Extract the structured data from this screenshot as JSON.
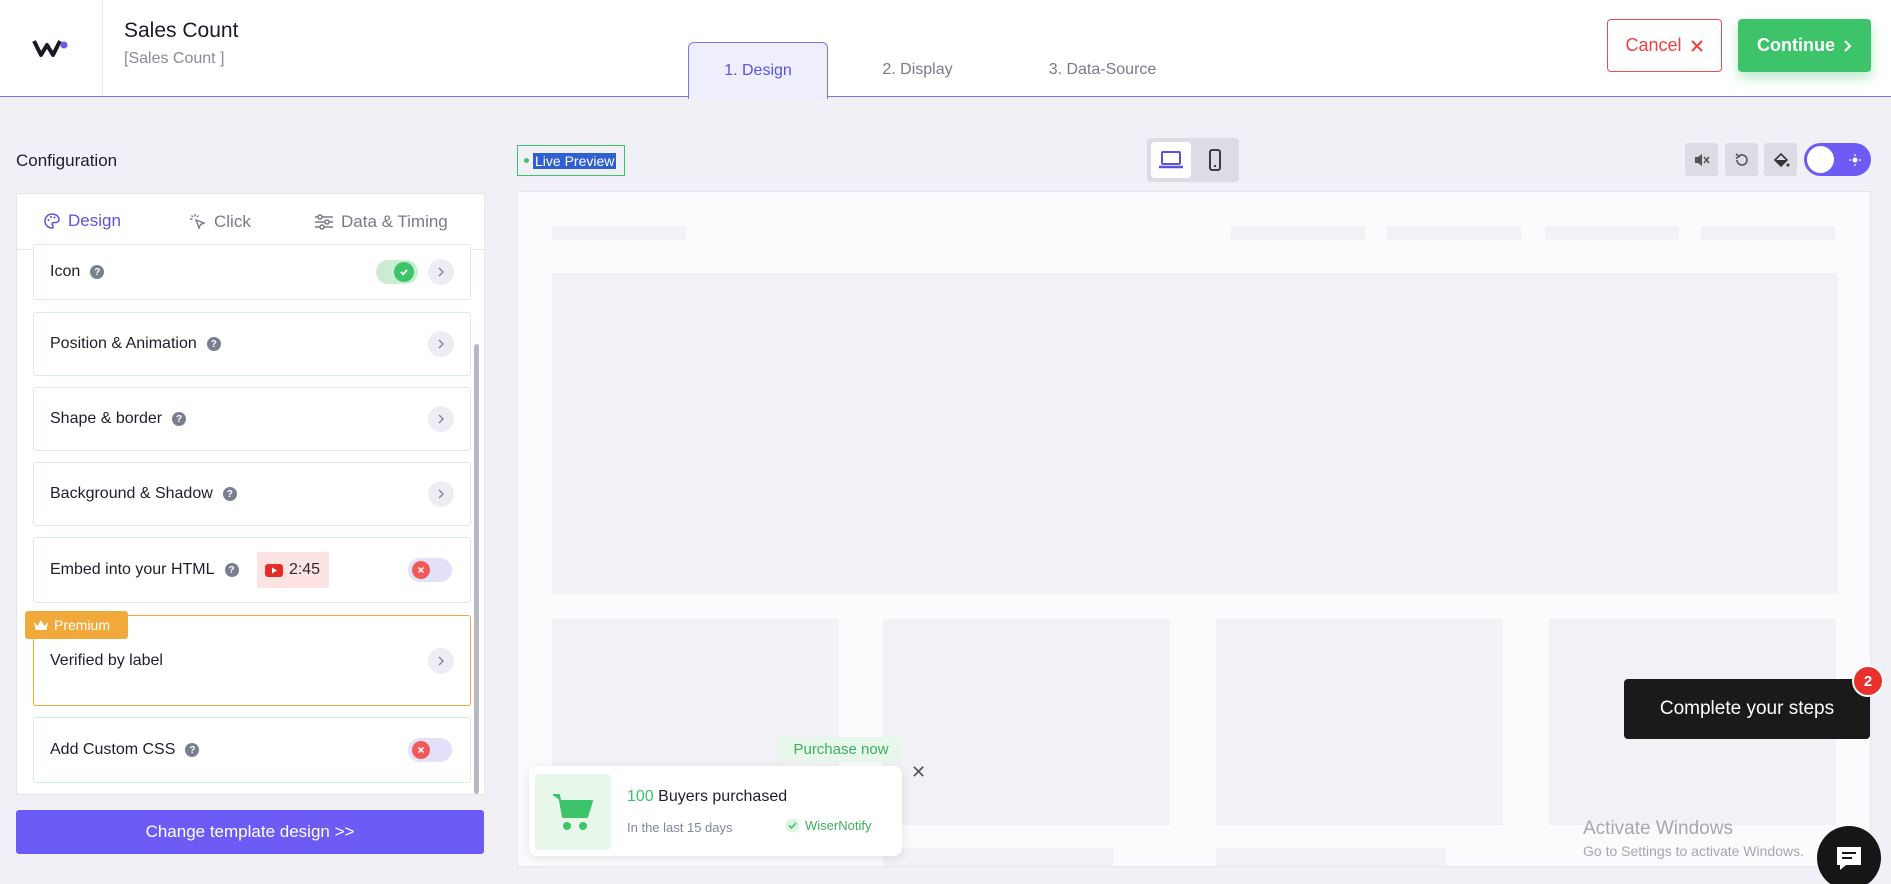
{
  "header": {
    "title": "Sales Count",
    "subtitle": "[Sales Count ]",
    "tabs": [
      {
        "label": "1. Design"
      },
      {
        "label": "2. Display"
      },
      {
        "label": "3. Data-Source"
      }
    ],
    "cancel_label": "Cancel",
    "continue_label": "Continue"
  },
  "sidebar": {
    "title": "Configuration",
    "subtabs": [
      {
        "label": "Design",
        "icon": "palette-icon"
      },
      {
        "label": "Click",
        "icon": "click-icon"
      },
      {
        "label": "Data & Timing",
        "icon": "sliders-icon"
      }
    ],
    "rows": [
      {
        "label": "Icon",
        "control": "toggle-on"
      },
      {
        "label": "Position & Animation",
        "control": "chevron"
      },
      {
        "label": "Shape & border",
        "control": "chevron"
      },
      {
        "label": "Background & Shadow",
        "control": "chevron"
      },
      {
        "label": "Embed into your HTML",
        "video": "2:45",
        "control": "toggle-off"
      },
      {
        "label": "Verified by label",
        "control": "chevron"
      },
      {
        "label": "Add Custom CSS",
        "control": "toggle-off"
      }
    ],
    "premium_label": "Premium",
    "change_template_label": "Change template design >>"
  },
  "preview": {
    "live_label": "Live Preview",
    "notification": {
      "cta": "Purchase now",
      "count": "100",
      "text": "Buyers purchased",
      "timeframe": "In the last 15 days",
      "brand": "WiserNotify"
    },
    "complete_steps": "Complete your steps",
    "steps_count": "2",
    "watermark_title": "Activate Windows",
    "watermark_sub": "Go to Settings to activate Windows."
  },
  "colors": {
    "accent": "#5a52e0",
    "primary_button": "#6c5cf5",
    "success": "#3dc46a",
    "danger": "#ef4040",
    "premium": "#f0a93a"
  }
}
